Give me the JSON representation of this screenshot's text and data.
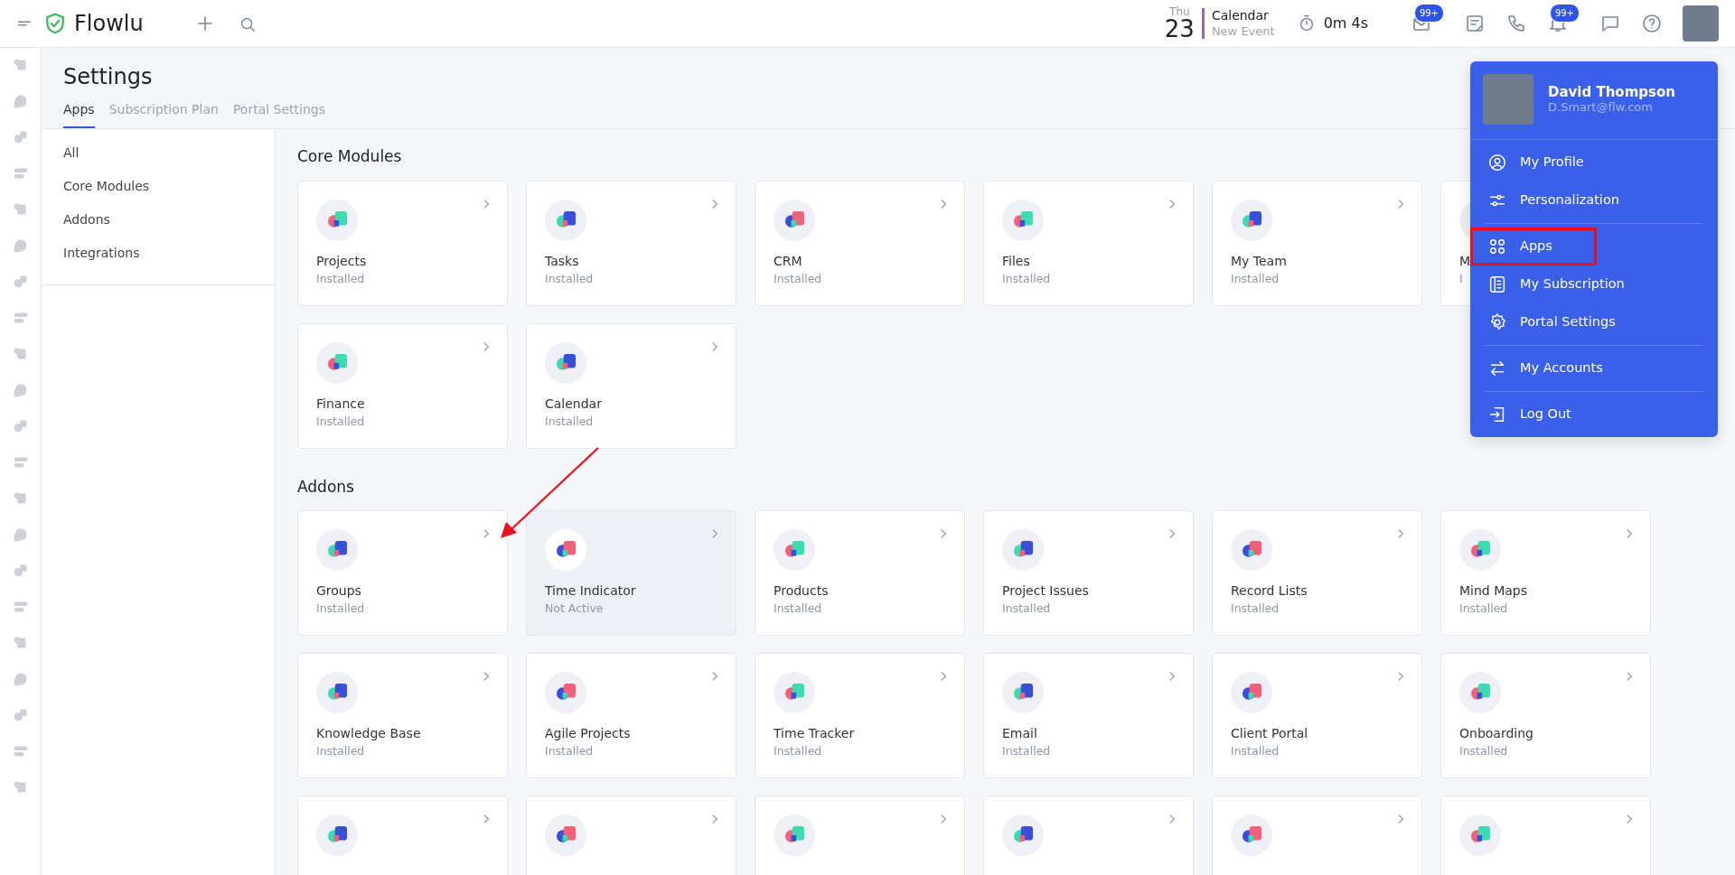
{
  "topbar": {
    "logo": "Flowlu",
    "date": {
      "weekday": "Thu",
      "day": "23"
    },
    "event": {
      "title": "Calendar",
      "subtitle": "New Event"
    },
    "timer": "0m 4s",
    "actions": [
      {
        "kind": "mail",
        "badge": "99+"
      },
      {
        "kind": "notes"
      },
      {
        "kind": "phone"
      },
      {
        "kind": "bell",
        "badge": "99+"
      },
      {
        "kind": "chat"
      },
      {
        "kind": "help"
      },
      {
        "kind": "avatar"
      }
    ]
  },
  "page": {
    "title": "Settings",
    "tabs": [
      {
        "label": "Apps",
        "selected": true
      },
      {
        "label": "Subscription Plan",
        "selected": false
      },
      {
        "label": "Portal Settings",
        "selected": false
      }
    ]
  },
  "filters": [
    "All",
    "Core Modules",
    "Addons",
    "Integrations"
  ],
  "sections": [
    {
      "title": "Core Modules",
      "apps": [
        {
          "kind": "app",
          "name": "Projects",
          "status": "Installed",
          "active": true
        },
        {
          "kind": "app",
          "name": "Tasks",
          "status": "Installed",
          "active": true
        },
        {
          "kind": "app",
          "name": "CRM",
          "status": "Installed",
          "active": true
        },
        {
          "kind": "app",
          "name": "Files",
          "status": "Installed",
          "active": true
        },
        {
          "kind": "app",
          "name": "My Team",
          "status": "Installed",
          "active": true
        },
        {
          "kind": "app",
          "name": "M",
          "status": "I",
          "active": true
        },
        {
          "kind": "app",
          "name": "Finance",
          "status": "Installed",
          "active": true
        },
        {
          "kind": "app",
          "name": "Calendar",
          "status": "Installed",
          "active": true
        }
      ]
    },
    {
      "title": "Addons",
      "apps": [
        {
          "kind": "app",
          "name": "Groups",
          "status": "Installed",
          "active": true
        },
        {
          "kind": "app",
          "name": "Time Indicator",
          "status": "Not Active",
          "active": false
        },
        {
          "kind": "app",
          "name": "Products",
          "status": "Installed",
          "active": true
        },
        {
          "kind": "app",
          "name": "Project Issues",
          "status": "Installed",
          "active": true
        },
        {
          "kind": "app",
          "name": "Record Lists",
          "status": "Installed",
          "active": true
        },
        {
          "kind": "app",
          "name": "Mind Maps",
          "status": "Installed",
          "active": true
        },
        {
          "kind": "app",
          "name": "Knowledge Base",
          "status": "Installed",
          "active": true
        },
        {
          "kind": "app",
          "name": "Agile Projects",
          "status": "Installed",
          "active": true
        },
        {
          "kind": "app",
          "name": "Time Tracker",
          "status": "Installed",
          "active": true
        },
        {
          "kind": "app",
          "name": "Email",
          "status": "Installed",
          "active": true
        },
        {
          "kind": "app",
          "name": "Client Portal",
          "status": "Installed",
          "active": true
        },
        {
          "kind": "app",
          "name": "Onboarding",
          "status": "Installed",
          "active": true
        },
        {
          "kind": "cut",
          "active": true
        },
        {
          "kind": "cut",
          "active": true
        },
        {
          "kind": "cut",
          "active": true
        },
        {
          "kind": "cut",
          "active": true
        },
        {
          "kind": "cut",
          "active": true
        },
        {
          "kind": "cut",
          "active": true
        }
      ]
    }
  ],
  "user_menu": {
    "name": "David Thompson",
    "email": "D.Smart@flw.com",
    "items": [
      {
        "kind": "profile",
        "label": "My Profile",
        "separated": false,
        "highlighted": false
      },
      {
        "kind": "sliders",
        "label": "Personalization",
        "separated": false,
        "highlighted": false
      },
      {
        "kind": "apps",
        "label": "Apps",
        "separated": true,
        "highlighted": true
      },
      {
        "kind": "subscription",
        "label": "My Subscription",
        "separated": false,
        "highlighted": false
      },
      {
        "kind": "gear",
        "label": "Portal Settings",
        "separated": false,
        "highlighted": false
      },
      {
        "kind": "swap",
        "label": "My Accounts",
        "separated": true,
        "highlighted": false
      },
      {
        "kind": "logout",
        "label": "Log Out",
        "separated": true,
        "highlighted": false
      }
    ]
  },
  "arrow_annotation": true
}
